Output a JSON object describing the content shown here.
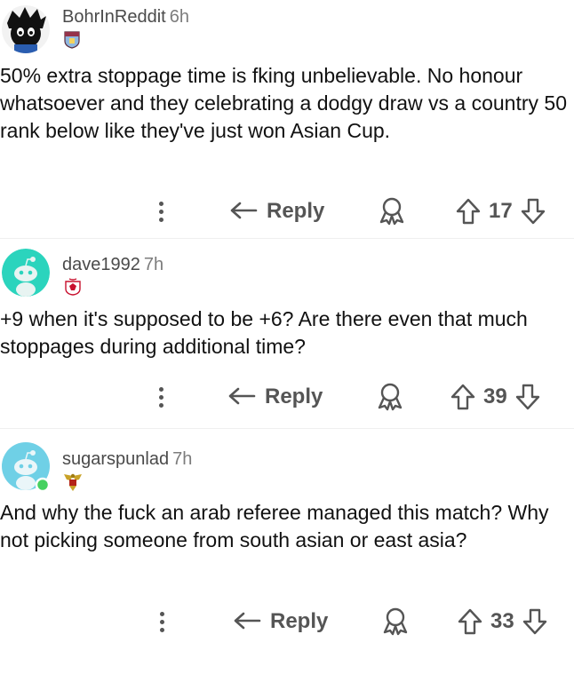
{
  "comments": [
    {
      "username": "BohrInReddit",
      "time": "6h",
      "body": "50% extra stoppage time is fking unbelievable. No honour whatsoever and they celebrating a dodgy draw vs a country 50 rank below like they've just won Asian Cup.",
      "reply_label": "Reply",
      "score": "17",
      "flair_icon": "club-crest-icon"
    },
    {
      "username": "dave1992",
      "time": "7h",
      "body": "+9 when it's supposed to be +6? Are there even that much stoppages during additional time?",
      "reply_label": "Reply",
      "score": "39",
      "flair_icon": "club-crest-icon"
    },
    {
      "username": "sugarspunlad",
      "time": "7h",
      "body": "And why the fuck an arab referee managed this match? Why not picking someone from south asian or east asia?",
      "reply_label": "Reply",
      "score": "33",
      "flair_icon": "garuda-emblem-icon"
    }
  ],
  "colors": {
    "avatar_teal": "#2bd4bd",
    "online_dot": "#46d160",
    "text_muted": "#7c7c7c",
    "action_gray": "#555555"
  }
}
